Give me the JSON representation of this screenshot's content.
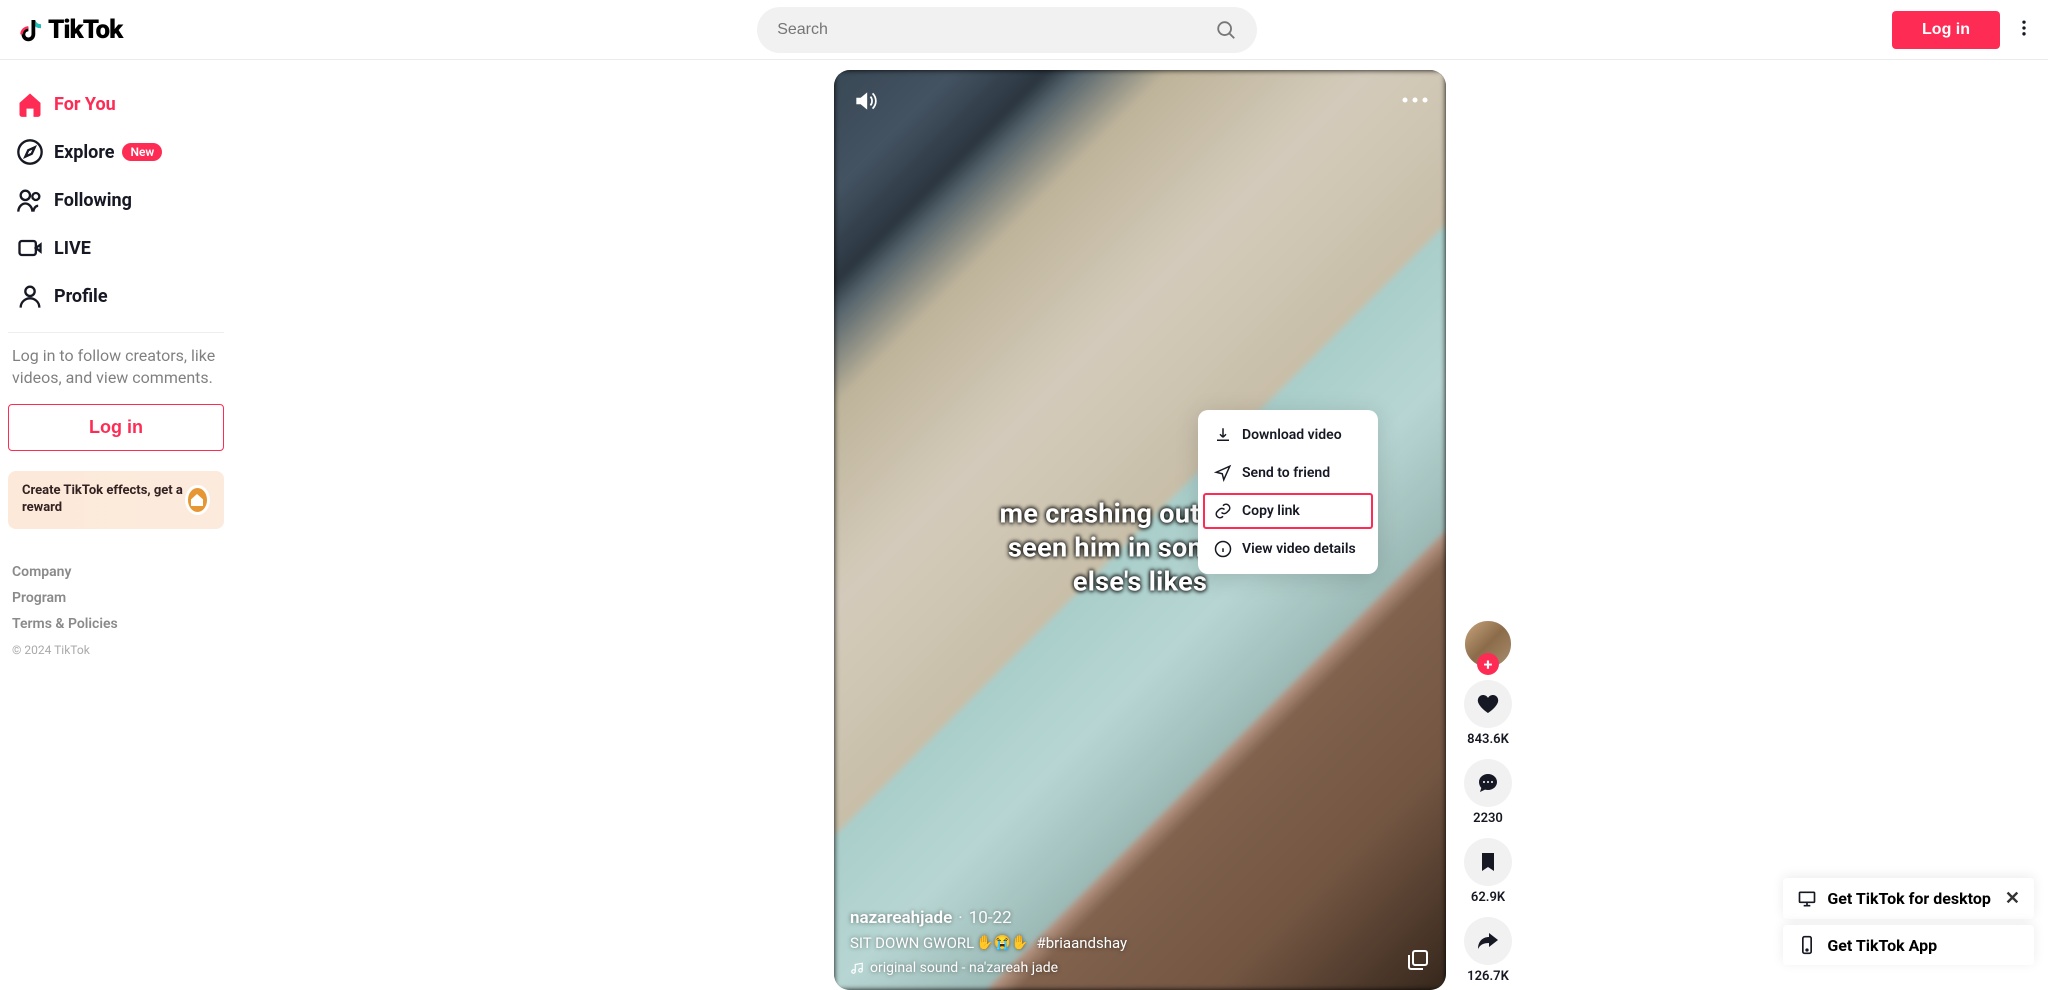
{
  "header": {
    "brand": "TikTok",
    "search_placeholder": "Search",
    "login_label": "Log in"
  },
  "sidebar": {
    "items": [
      {
        "label": "For You",
        "icon": "home",
        "active": true
      },
      {
        "label": "Explore",
        "icon": "compass",
        "active": false,
        "badge": "New"
      },
      {
        "label": "Following",
        "icon": "people",
        "active": false
      },
      {
        "label": "LIVE",
        "icon": "live",
        "active": false
      },
      {
        "label": "Profile",
        "icon": "person",
        "active": false
      }
    ],
    "login_prompt": "Log in to follow creators, like videos, and view comments.",
    "login_button": "Log in",
    "effects_text": "Create TikTok effects, get a reward",
    "footer": {
      "company": "Company",
      "program": "Program",
      "terms": "Terms & Policies",
      "copyright": "© 2024 TikTok"
    }
  },
  "video": {
    "overlay_text": "me crashing out after i seen him in someone else's likes",
    "author": "nazareahjade",
    "date_sep": "·",
    "date": "10-22",
    "caption_text": "SIT DOWN GWORL",
    "caption_emoji": "✋😭✋",
    "hashtag": "#briaandshay",
    "sound": "original sound - na'zareah jade"
  },
  "actions": {
    "like_count": "843.6K",
    "comment_count": "2230",
    "bookmark_count": "62.9K",
    "share_count": "126.7K"
  },
  "context_menu": {
    "download": "Download video",
    "send": "Send to friend",
    "copy": "Copy link",
    "details": "View video details"
  },
  "bottom_right": {
    "desktop": "Get TikTok for desktop",
    "app": "Get TikTok App"
  }
}
